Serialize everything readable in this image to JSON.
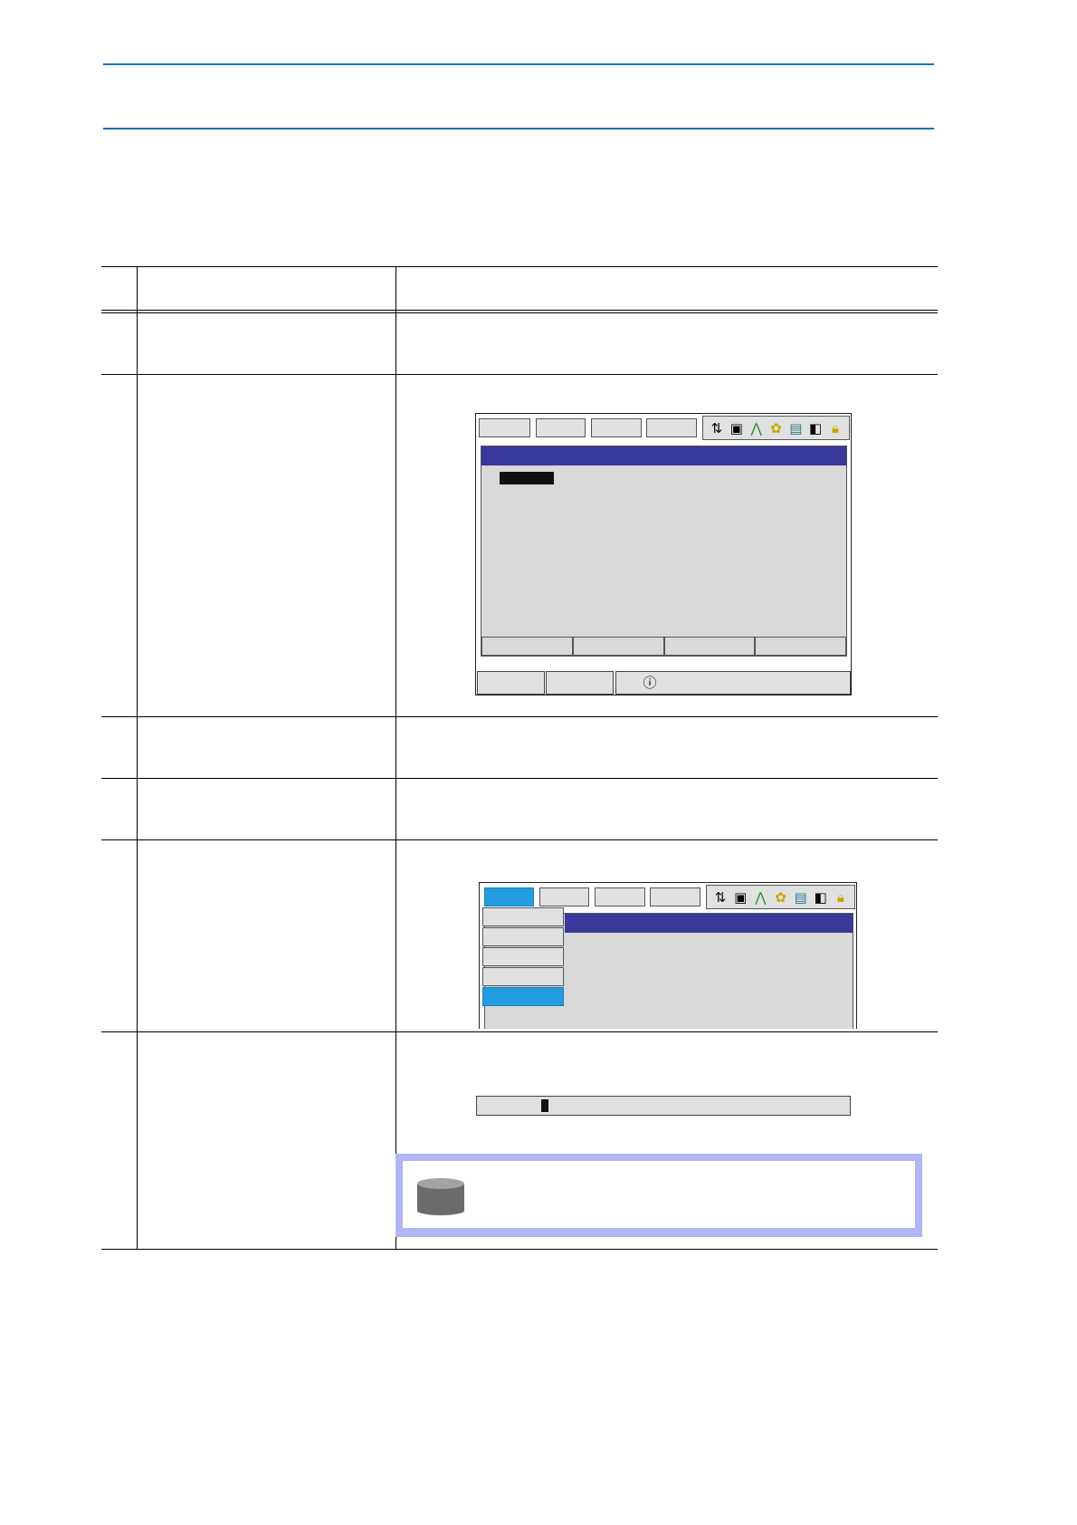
{
  "page": {
    "accent_color": "#1c6fb8"
  },
  "screen1": {
    "title_bar_color": "#38399a",
    "status_icons": [
      "axis-toggle-icon",
      "edit-mode-icon",
      "motion-type-icon",
      "robot-status-icon",
      "frame-icon",
      "storage-icon",
      "security-lock-icon"
    ],
    "info_icon": "info-bubble-icon"
  },
  "screen2": {
    "title_bar_color": "#38399a",
    "selected_color": "#229ee0",
    "status_icons": [
      "axis-toggle-icon",
      "edit-mode-icon",
      "motion-type-icon",
      "robot-status-icon",
      "frame-icon",
      "storage-icon",
      "security-lock-icon"
    ]
  },
  "note": {
    "icon": "database-cylinder-icon",
    "frame_color": "#b3b6f4"
  }
}
